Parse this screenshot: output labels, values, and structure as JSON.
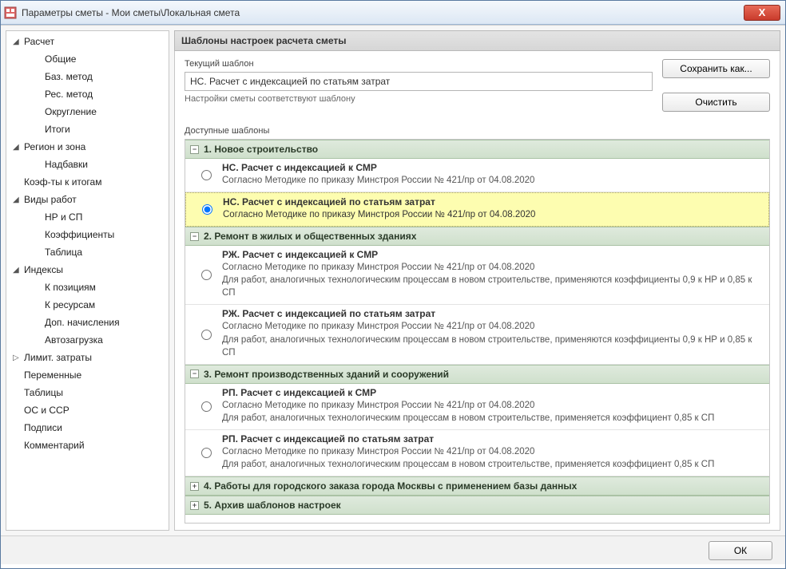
{
  "window": {
    "title": "Параметры сметы - Мои сметы\\Локальная смета",
    "close": "X"
  },
  "sidebar": {
    "items": [
      {
        "label": "Расчет",
        "level": 0,
        "arrow": "◢"
      },
      {
        "label": "Общие",
        "level": 1,
        "arrow": ""
      },
      {
        "label": "Баз. метод",
        "level": 1,
        "arrow": ""
      },
      {
        "label": "Рес. метод",
        "level": 1,
        "arrow": ""
      },
      {
        "label": "Округление",
        "level": 1,
        "arrow": ""
      },
      {
        "label": "Итоги",
        "level": 1,
        "arrow": ""
      },
      {
        "label": "Регион и зона",
        "level": 0,
        "arrow": "◢"
      },
      {
        "label": "Надбавки",
        "level": 1,
        "arrow": ""
      },
      {
        "label": "Коэф-ты к итогам",
        "level": 0,
        "arrow": ""
      },
      {
        "label": "Виды работ",
        "level": 0,
        "arrow": "◢"
      },
      {
        "label": "НР и СП",
        "level": 1,
        "arrow": ""
      },
      {
        "label": "Коэффициенты",
        "level": 1,
        "arrow": ""
      },
      {
        "label": "Таблица",
        "level": 1,
        "arrow": ""
      },
      {
        "label": "Индексы",
        "level": 0,
        "arrow": "◢"
      },
      {
        "label": "К позициям",
        "level": 1,
        "arrow": ""
      },
      {
        "label": "К ресурсам",
        "level": 1,
        "arrow": ""
      },
      {
        "label": "Доп. начисления",
        "level": 1,
        "arrow": ""
      },
      {
        "label": "Автозагрузка",
        "level": 1,
        "arrow": ""
      },
      {
        "label": "Лимит. затраты",
        "level": 0,
        "arrow": "▷"
      },
      {
        "label": "Переменные",
        "level": 0,
        "arrow": ""
      },
      {
        "label": "Таблицы",
        "level": 0,
        "arrow": ""
      },
      {
        "label": "ОС и ССР",
        "level": 0,
        "arrow": ""
      },
      {
        "label": "Подписи",
        "level": 0,
        "arrow": ""
      },
      {
        "label": "Комментарий",
        "level": 0,
        "arrow": ""
      }
    ]
  },
  "main": {
    "header": "Шаблоны настроек расчета сметы",
    "current_label": "Текущий шаблон",
    "current_value": "НС. Расчет с индексацией по статьям затрат",
    "match_note": "Настройки сметы соответствуют шаблону",
    "save_as": "Сохранить как...",
    "clear": "Очистить",
    "avail_label": "Доступные шаблоны"
  },
  "groups": [
    {
      "title": "1. Новое строительство",
      "expanded": "−",
      "items": [
        {
          "title": "НС. Расчет с индексацией к СМР",
          "desc": "Согласно Методике по приказу Минстроя России № 421/пр от 04.08.2020",
          "selected": false
        },
        {
          "title": "НС. Расчет с индексацией по статьям затрат",
          "desc": "Согласно Методике по приказу Минстроя России № 421/пр от 04.08.2020",
          "selected": true
        }
      ]
    },
    {
      "title": "2. Ремонт в жилых и общественных зданиях",
      "expanded": "−",
      "items": [
        {
          "title": "РЖ. Расчет с индексацией к СМР",
          "desc": "Согласно Методике по приказу Минстроя России № 421/пр от 04.08.2020\nДля работ, аналогичных технологическим процессам в новом строительстве, применяются коэффициенты 0,9 к НР и 0,85 к СП",
          "selected": false
        },
        {
          "title": "РЖ. Расчет с индексацией по статьям затрат",
          "desc": "Согласно Методике по приказу Минстроя России № 421/пр от 04.08.2020\nДля работ, аналогичных технологическим процессам в новом строительстве, применяются коэффициенты 0,9 к НР и 0,85 к СП",
          "selected": false
        }
      ]
    },
    {
      "title": "3. Ремонт производственных зданий и сооружений",
      "expanded": "−",
      "items": [
        {
          "title": "РП. Расчет с индексацией к СМР",
          "desc": "Согласно Методике по приказу Минстроя России № 421/пр от 04.08.2020\nДля работ, аналогичных технологическим процессам в новом строительстве, применяется коэффициент 0,85 к СП",
          "selected": false
        },
        {
          "title": "РП. Расчет с индексацией по статьям затрат",
          "desc": "Согласно Методике по приказу Минстроя России № 421/пр от 04.08.2020\nДля работ, аналогичных технологическим процессам в новом строительстве, применяется коэффициент 0,85 к СП",
          "selected": false
        }
      ]
    },
    {
      "title": "4. Работы для городского заказа города Москвы с применением базы данных",
      "expanded": "+",
      "items": []
    },
    {
      "title": "5. Архив шаблонов настроек",
      "expanded": "+",
      "items": []
    }
  ],
  "footer": {
    "ok": "ОК"
  }
}
